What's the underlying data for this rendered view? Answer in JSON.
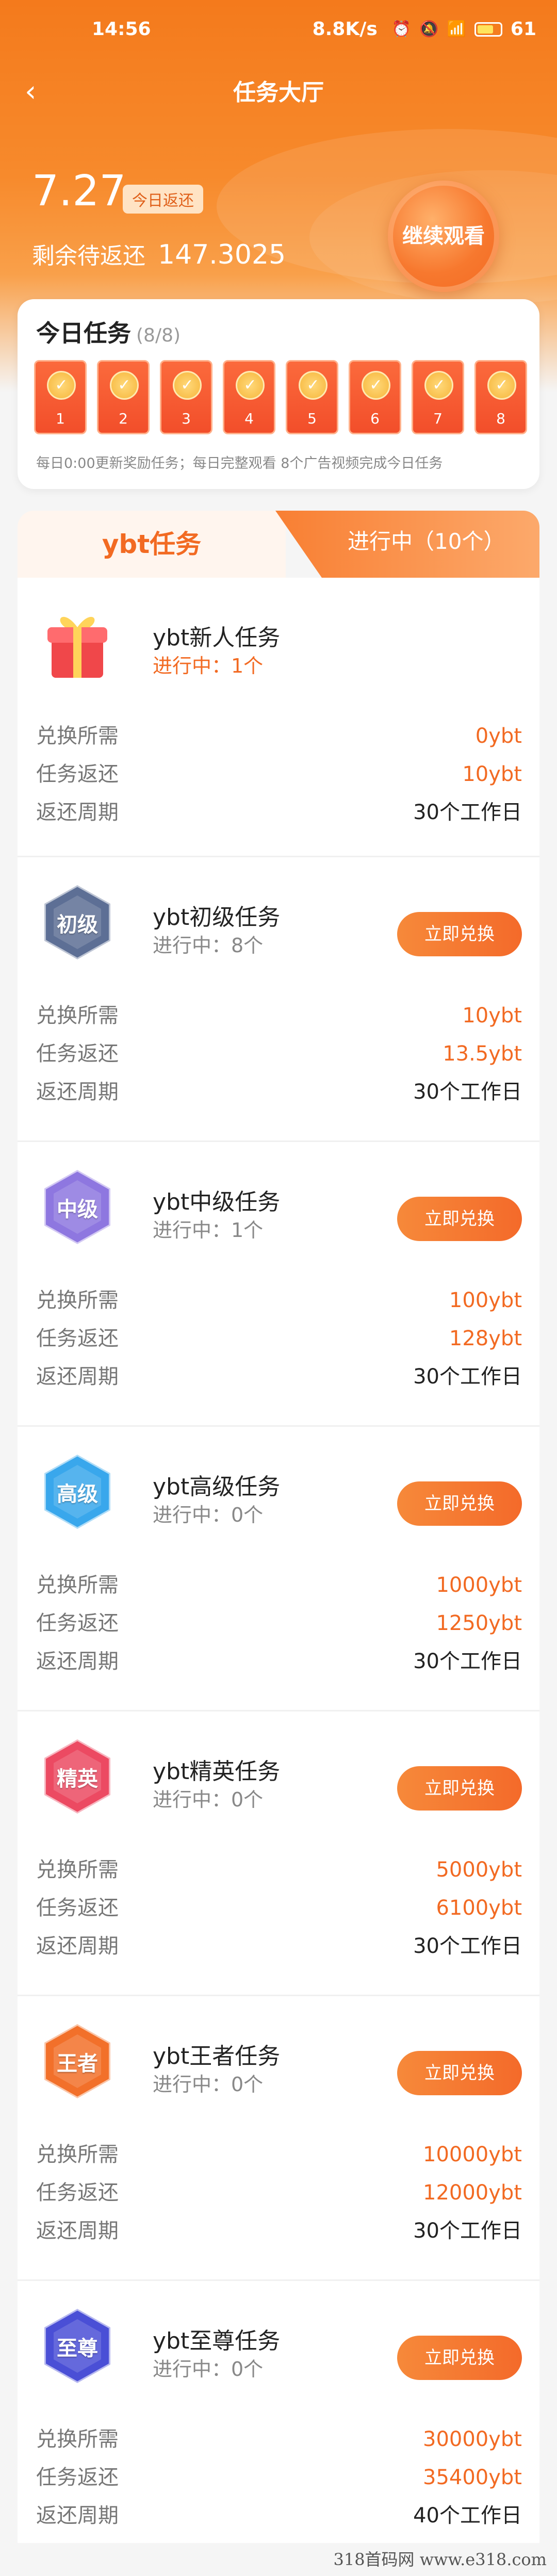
{
  "status_bar": {
    "time": "14:56",
    "speed": "8.8K/s",
    "battery": "61"
  },
  "nav": {
    "back_icon": "chevron-left-icon",
    "title": "任务大厅"
  },
  "summary": {
    "today_value": "7.27",
    "today_tag": "今日返还",
    "remain_label": "剩余待返还",
    "remain_value": "147.3025",
    "watch_button": "继续观看"
  },
  "today_tasks": {
    "title": "今日任务",
    "count": "(8/8)",
    "slots": [
      "1",
      "2",
      "3",
      "4",
      "5",
      "6",
      "7",
      "8"
    ],
    "tip": "每日0:00更新奖励任务；每日完整观看 8个广告视频完成今日任务"
  },
  "tabs": {
    "left": "ybt任务",
    "right": "进行中（10个）"
  },
  "labels": {
    "cost": "兑换所需",
    "rebate": "任务返还",
    "period": "返还周期",
    "redeem": "立即兑换"
  },
  "tasks": [
    {
      "badge": "",
      "name": "ybt新人任务",
      "progress": "进行中：1个",
      "cost": "0ybt",
      "rebate": "10ybt",
      "period": "30个工作日",
      "color": "#f0474a",
      "has_button": false
    },
    {
      "badge": "初级",
      "name": "ybt初级任务",
      "progress": "进行中：8个",
      "cost": "10ybt",
      "rebate": "13.5ybt",
      "period": "30个工作日",
      "color": "#5d6f95",
      "has_button": true
    },
    {
      "badge": "中级",
      "name": "ybt中级任务",
      "progress": "进行中：1个",
      "cost": "100ybt",
      "rebate": "128ybt",
      "period": "30个工作日",
      "color": "#8e77e0",
      "has_button": true
    },
    {
      "badge": "高级",
      "name": "ybt高级任务",
      "progress": "进行中：0个",
      "cost": "1000ybt",
      "rebate": "1250ybt",
      "period": "30个工作日",
      "color": "#39a7ec",
      "has_button": true
    },
    {
      "badge": "精英",
      "name": "ybt精英任务",
      "progress": "进行中：0个",
      "cost": "5000ybt",
      "rebate": "6100ybt",
      "period": "30个工作日",
      "color": "#ec4a62",
      "has_button": true
    },
    {
      "badge": "王者",
      "name": "ybt王者任务",
      "progress": "进行中：0个",
      "cost": "10000ybt",
      "rebate": "12000ybt",
      "period": "30个工作日",
      "color": "#f2702a",
      "has_button": true
    },
    {
      "badge": "至尊",
      "name": "ybt至尊任务",
      "progress": "进行中：0个",
      "cost": "30000ybt",
      "rebate": "35400ybt",
      "period": "40个工作日",
      "color": "#4a4fd6",
      "has_button": true
    }
  ],
  "watermark": "318首码网 www.e318.com"
}
